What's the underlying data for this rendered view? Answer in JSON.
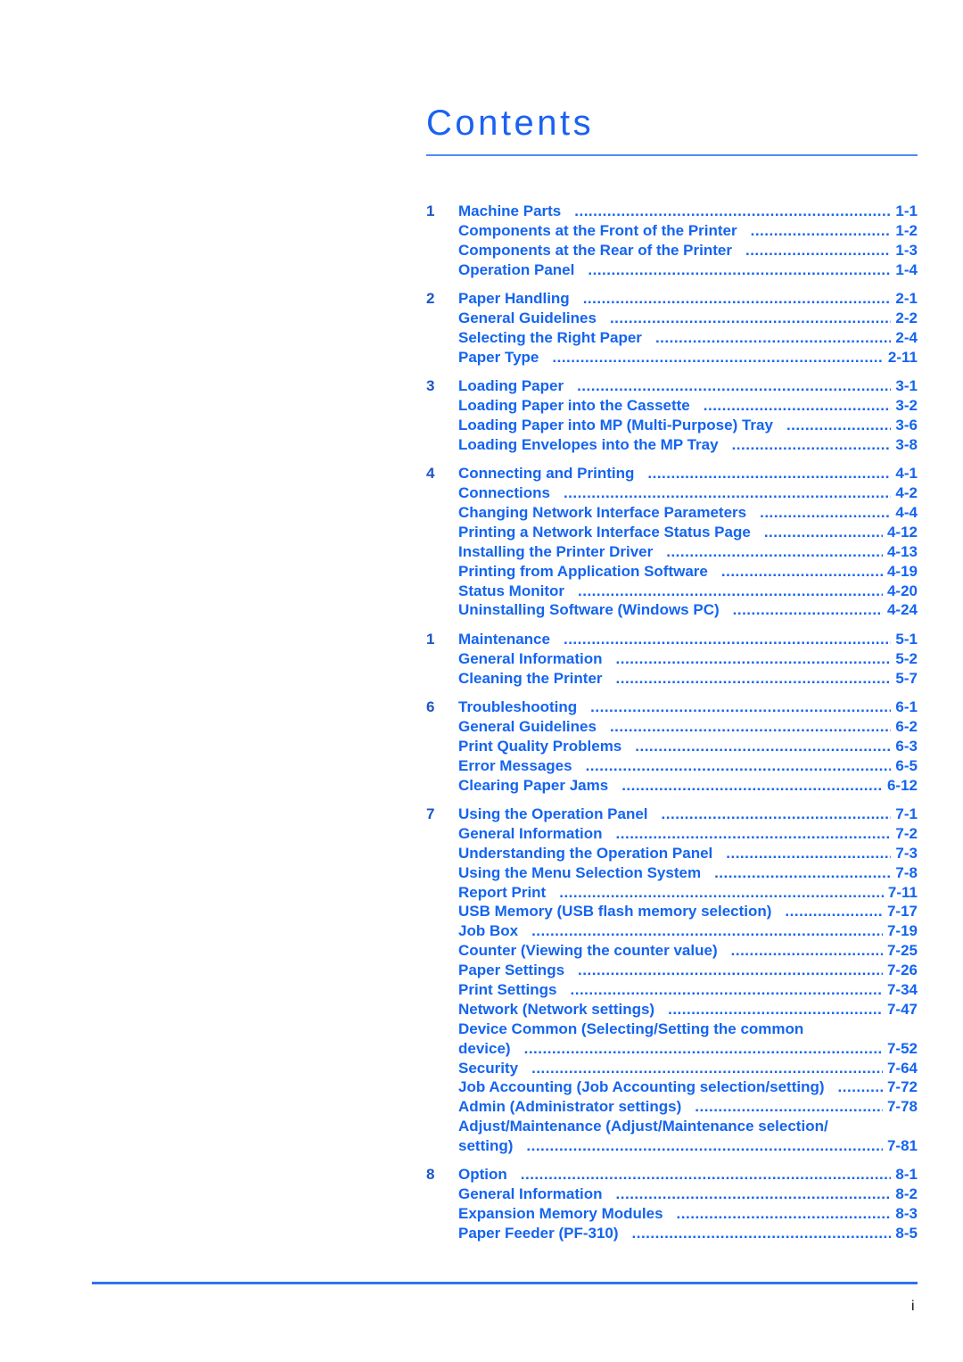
{
  "title": "Contents",
  "footer": {
    "page_number": "i"
  },
  "colors": {
    "title": "#1a62f0",
    "entry_text": "#1464f0",
    "chapter_number": "#1c56c8",
    "rule": "#2e72f0"
  },
  "chapters": [
    {
      "number": "1",
      "entries": [
        {
          "label": "Machine Parts",
          "page": "1-1"
        },
        {
          "label": "Components at the Front of the Printer",
          "page": "1-2"
        },
        {
          "label": "Components at the Rear of the Printer",
          "page": "1-3"
        },
        {
          "label": "Operation Panel",
          "page": "1-4"
        }
      ]
    },
    {
      "number": "2",
      "entries": [
        {
          "label": "Paper Handling",
          "page": "2-1"
        },
        {
          "label": "General Guidelines",
          "page": "2-2"
        },
        {
          "label": "Selecting the Right Paper",
          "page": "2-4"
        },
        {
          "label": "Paper Type",
          "page": "2-11"
        }
      ]
    },
    {
      "number": "3",
      "entries": [
        {
          "label": "Loading Paper",
          "page": "3-1"
        },
        {
          "label": "Loading Paper into the Cassette",
          "page": "3-2"
        },
        {
          "label": "Loading Paper into MP (Multi-Purpose) Tray",
          "page": "3-6"
        },
        {
          "label": "Loading Envelopes into the MP Tray",
          "page": "3-8"
        }
      ]
    },
    {
      "number": "4",
      "entries": [
        {
          "label": "Connecting and Printing",
          "page": "4-1"
        },
        {
          "label": "Connections",
          "page": "4-2"
        },
        {
          "label": "Changing Network Interface Parameters",
          "page": "4-4"
        },
        {
          "label": "Printing a Network Interface Status Page",
          "page": "4-12"
        },
        {
          "label": "Installing the Printer Driver",
          "page": "4-13"
        },
        {
          "label": "Printing from Application Software",
          "page": "4-19"
        },
        {
          "label": "Status Monitor",
          "page": "4-20"
        },
        {
          "label": "Uninstalling Software (Windows PC)",
          "page": "4-24"
        }
      ]
    },
    {
      "number": "1",
      "entries": [
        {
          "label": "Maintenance",
          "page": "5-1"
        },
        {
          "label": "General Information",
          "page": "5-2"
        },
        {
          "label": "Cleaning the Printer",
          "page": "5-7"
        }
      ]
    },
    {
      "number": "6",
      "entries": [
        {
          "label": "Troubleshooting",
          "page": "6-1"
        },
        {
          "label": "General Guidelines",
          "page": "6-2"
        },
        {
          "label": "Print Quality Problems",
          "page": "6-3"
        },
        {
          "label": "Error Messages",
          "page": "6-5"
        },
        {
          "label": "Clearing Paper Jams",
          "page": "6-12"
        }
      ]
    },
    {
      "number": "7",
      "entries": [
        {
          "label": "Using the Operation Panel",
          "page": "7-1"
        },
        {
          "label": "General Information",
          "page": "7-2"
        },
        {
          "label": "Understanding the Operation Panel",
          "page": "7-3"
        },
        {
          "label": "Using the Menu Selection System",
          "page": "7-8"
        },
        {
          "label": "Report Print",
          "page": "7-11"
        },
        {
          "label": "USB Memory (USB flash memory selection)",
          "page": "7-17"
        },
        {
          "label": "Job Box",
          "page": "7-19"
        },
        {
          "label": "Counter (Viewing the counter value)",
          "page": "7-25"
        },
        {
          "label": "Paper Settings",
          "page": "7-26"
        },
        {
          "label": "Print Settings",
          "page": "7-34"
        },
        {
          "label": "Network (Network settings)",
          "page": "7-47"
        },
        {
          "label": "Device Common (Selecting/Setting the common",
          "label_cont": "device)",
          "page": "7-52"
        },
        {
          "label": "Security",
          "page": "7-64"
        },
        {
          "label": "Job Accounting (Job Accounting selection/setting)",
          "page": "7-72"
        },
        {
          "label": "Admin (Administrator settings)",
          "page": "7-78"
        },
        {
          "label": "Adjust/Maintenance (Adjust/Maintenance selection/",
          "label_cont": "setting)",
          "page": "7-81"
        }
      ]
    },
    {
      "number": "8",
      "entries": [
        {
          "label": "Option",
          "page": "8-1"
        },
        {
          "label": "General Information",
          "page": "8-2"
        },
        {
          "label": "Expansion Memory Modules",
          "page": "8-3"
        },
        {
          "label": "Paper Feeder (PF-310)",
          "page": "8-5"
        }
      ]
    }
  ]
}
